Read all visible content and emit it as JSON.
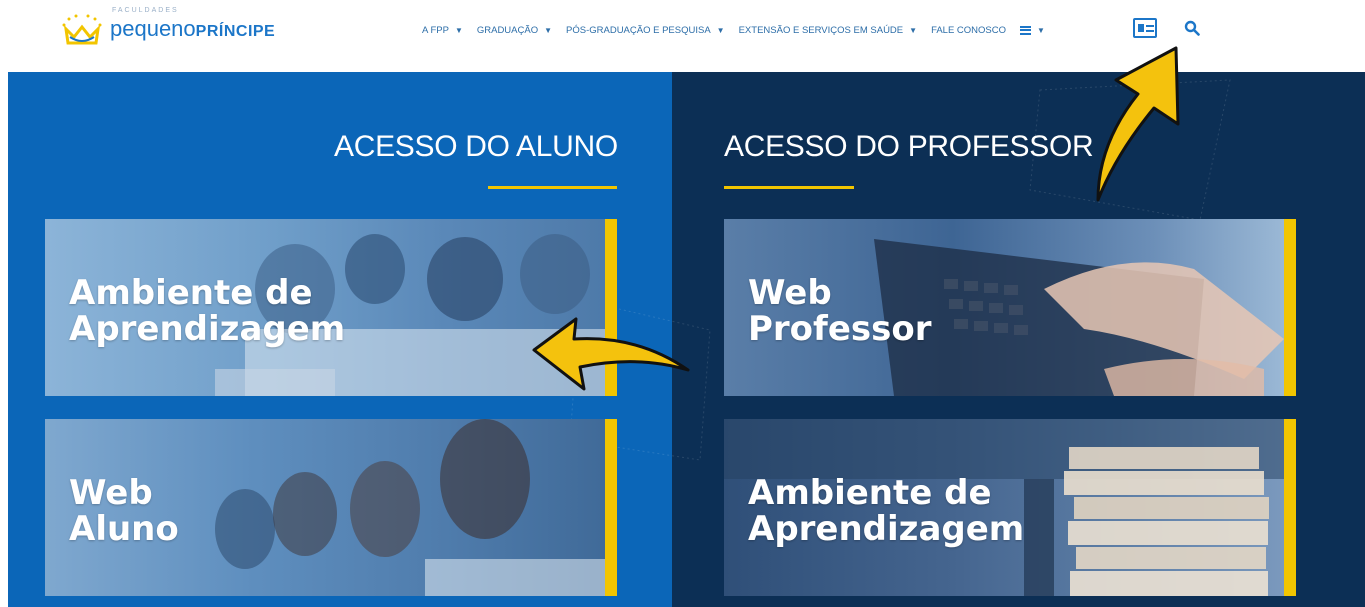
{
  "header": {
    "logo": {
      "small_text": "FACULDADES",
      "main_text": "pequeno",
      "bold_text": "PRÍNCIPE"
    },
    "nav": [
      {
        "label": "A FPP"
      },
      {
        "label": "GRADUAÇÃO"
      },
      {
        "label": "PÓS-GRADUAÇÃO E PESQUISA"
      },
      {
        "label": "EXTENSÃO E SERVIÇOS EM SAÚDE"
      },
      {
        "label": "FALE CONOSCO"
      }
    ],
    "icons": {
      "chevron": "chevron-down-icon",
      "menu": "hamburger-menu-icon",
      "access": "id-card-icon",
      "search": "search-icon"
    }
  },
  "student": {
    "title": "ACESSO DO ALUNO",
    "tiles": [
      {
        "label": "Ambiente de\nAprendizagem"
      },
      {
        "label": "Web\nAluno"
      }
    ]
  },
  "teacher": {
    "title": "ACESSO DO PROFESSOR",
    "tiles": [
      {
        "label": "Web\nProfessor"
      },
      {
        "label": "Ambiente de\nAprendizagem"
      }
    ]
  },
  "colors": {
    "student_bg": "#0b66b8",
    "teacher_bg": "#0c2f55",
    "accent_yellow": "#f2c500",
    "brand_blue": "#1c76c8"
  }
}
